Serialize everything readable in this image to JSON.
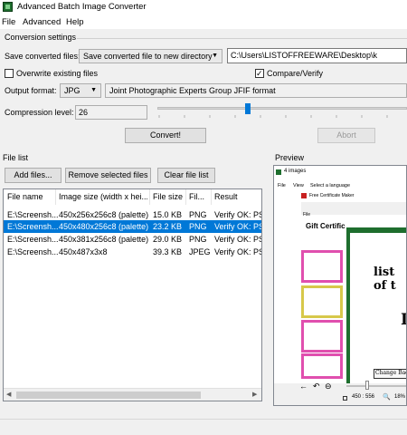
{
  "window": {
    "title": "Advanced Batch Image Converter"
  },
  "menu": [
    "File",
    "Advanced",
    "Help"
  ],
  "conversion": {
    "section_label": "Conversion settings",
    "save_label": "Save converted files:",
    "save_mode": "Save converted file to new directory",
    "output_dir": "C:\\Users\\LISTOFFREEWARE\\Desktop\\k",
    "overwrite_label": "Overwrite existing files",
    "overwrite_checked": false,
    "compare_label": "Compare/Verify",
    "compare_checked": true,
    "format_label": "Output format:",
    "format_value": "JPG",
    "format_description": "Joint Photographic Experts Group JFIF format",
    "compression_label": "Compression level:",
    "compression_value": "26",
    "convert_button": "Convert!",
    "abort_button": "Abort"
  },
  "file_list": {
    "section_label": "File list",
    "add_button": "Add files...",
    "remove_button": "Remove selected files",
    "clear_button": "Clear file list",
    "columns": [
      "File name",
      "Image size (width x hei...",
      "File size",
      "Fil...",
      "Result"
    ],
    "rows": [
      [
        "E:\\Screensh...",
        "450x256x256c8 (palette)",
        "15.0 KB",
        "PNG",
        "Verify OK: PSI"
      ],
      [
        "E:\\Screensh...",
        "450x480x256c8 (palette)",
        "23.2 KB",
        "PNG",
        "Verify OK: PSI"
      ],
      [
        "E:\\Screensh...",
        "450x381x256c8 (palette)",
        "29.0 KB",
        "PNG",
        "Verify OK: PSI"
      ],
      [
        "E:\\Screensh...",
        "450x487x3x8",
        "39.3 KB",
        "JPEG",
        "Verify OK: PSI"
      ]
    ],
    "selected_row": 1
  },
  "preview": {
    "section_label": "Preview",
    "inner_title": "4 images",
    "inner_menu": [
      "File",
      "View",
      "Select a language"
    ],
    "inner_doc_title": "Free Certificate Maker",
    "inner_file_label": "File",
    "gift_text": "Gift Certific",
    "list_text": "list of t",
    "big_letter": "Ij",
    "change_button": "Change Backg",
    "status_dims": "450 : 556",
    "status_zoom": "18%"
  },
  "colors": {
    "selection": "#0078d7",
    "accent_green": "#1e6e2e",
    "thumb_pink": "#e04fae"
  }
}
